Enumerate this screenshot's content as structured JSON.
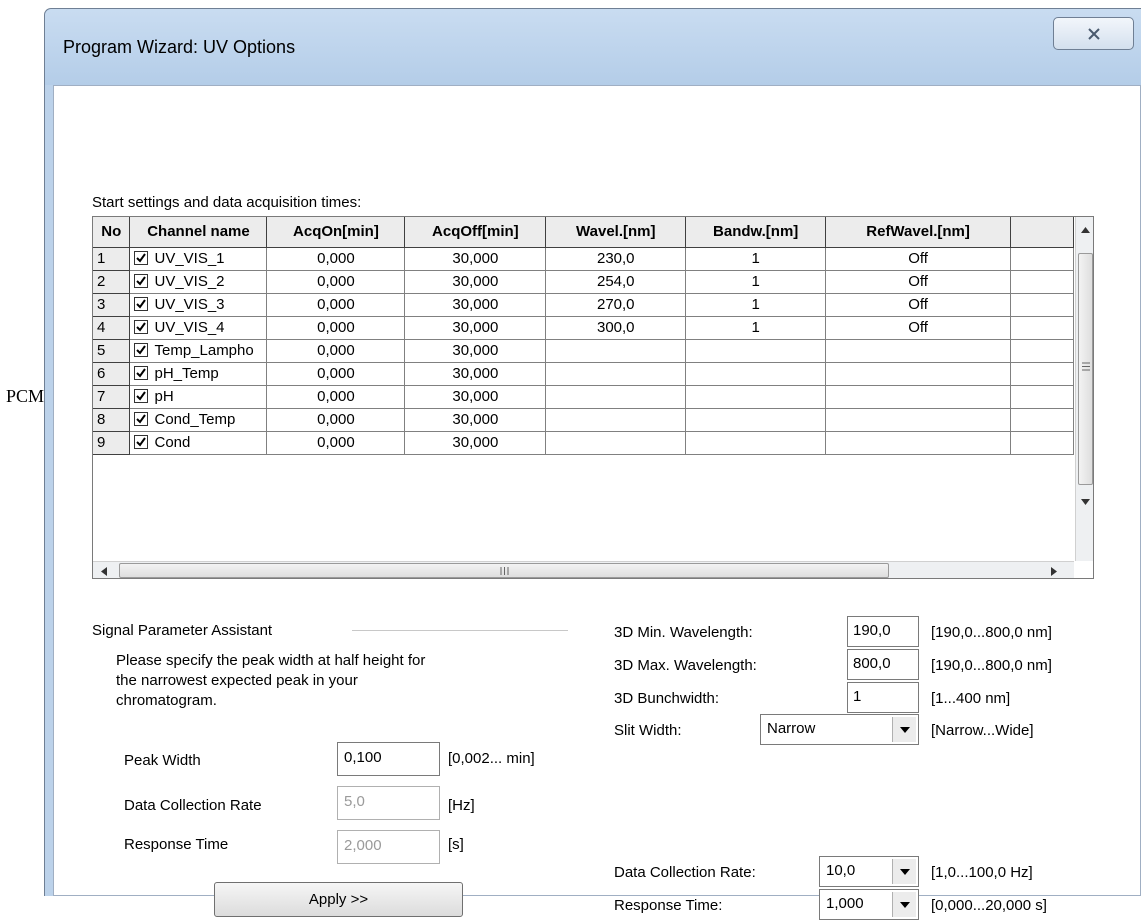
{
  "annotation": {
    "label": "PCM"
  },
  "window": {
    "title": "Program Wizard: UV Options",
    "close_icon": "close-icon"
  },
  "grid": {
    "caption": "Start settings and data acquisition times:",
    "columns": [
      "No",
      "Channel name",
      "AcqOn[min]",
      "AcqOff[min]",
      "Wavel.[nm]",
      "Bandw.[nm]",
      "RefWavel.[nm]"
    ],
    "rows": [
      {
        "no": "1",
        "checked": true,
        "name": "UV_VIS_1",
        "acq_on": "0,000",
        "acq_off": "30,000",
        "wavel": "230,0",
        "bandw": "1",
        "ref": "Off"
      },
      {
        "no": "2",
        "checked": true,
        "name": "UV_VIS_2",
        "acq_on": "0,000",
        "acq_off": "30,000",
        "wavel": "254,0",
        "bandw": "1",
        "ref": "Off"
      },
      {
        "no": "3",
        "checked": true,
        "name": "UV_VIS_3",
        "acq_on": "0,000",
        "acq_off": "30,000",
        "wavel": "270,0",
        "bandw": "1",
        "ref": "Off"
      },
      {
        "no": "4",
        "checked": true,
        "name": "UV_VIS_4",
        "acq_on": "0,000",
        "acq_off": "30,000",
        "wavel": "300,0",
        "bandw": "1",
        "ref": "Off"
      },
      {
        "no": "5",
        "checked": true,
        "name": "Temp_Lampho",
        "acq_on": "0,000",
        "acq_off": "30,000",
        "wavel": "",
        "bandw": "",
        "ref": ""
      },
      {
        "no": "6",
        "checked": true,
        "name": "pH_Temp",
        "acq_on": "0,000",
        "acq_off": "30,000",
        "wavel": "",
        "bandw": "",
        "ref": ""
      },
      {
        "no": "7",
        "checked": true,
        "name": "pH",
        "acq_on": "0,000",
        "acq_off": "30,000",
        "wavel": "",
        "bandw": "",
        "ref": ""
      },
      {
        "no": "8",
        "checked": true,
        "name": "Cond_Temp",
        "acq_on": "0,000",
        "acq_off": "30,000",
        "wavel": "",
        "bandw": "",
        "ref": ""
      },
      {
        "no": "9",
        "checked": true,
        "name": "Cond",
        "acq_on": "0,000",
        "acq_off": "30,000",
        "wavel": "",
        "bandw": "",
        "ref": ""
      }
    ]
  },
  "signal": {
    "group_title": "Signal Parameter Assistant",
    "description_lines": [
      "Please specify the peak width at half height for",
      "the narrowest expected peak in your",
      "chromatogram."
    ],
    "peak_width": {
      "label": "Peak Width",
      "value": "0,100",
      "range": "[0,002... min]"
    },
    "data_rate": {
      "label": "Data Collection Rate",
      "value": "5,0",
      "unit": "[Hz]"
    },
    "response": {
      "label": "Response Time",
      "value": "2,000",
      "unit": "[s]"
    },
    "apply_label": "Apply >>"
  },
  "settings3d": {
    "min_wave": {
      "label": "3D Min. Wavelength:",
      "value": "190,0",
      "range": "[190,0...800,0 nm]"
    },
    "max_wave": {
      "label": "3D Max. Wavelength:",
      "value": "800,0",
      "range": "[190,0...800,0 nm]"
    },
    "bunch": {
      "label": "3D Bunchwidth:",
      "value": "1",
      "range": "[1...400 nm]"
    },
    "slit": {
      "label": "Slit Width:",
      "value": "Narrow",
      "range": "[Narrow...Wide]"
    },
    "rate": {
      "label": "Data Collection Rate:",
      "value": "10,0",
      "range": "[1,0...100,0 Hz]"
    },
    "response": {
      "label": "Response Time:",
      "value": "1,000",
      "range": "[0,000...20,000 s]"
    }
  }
}
